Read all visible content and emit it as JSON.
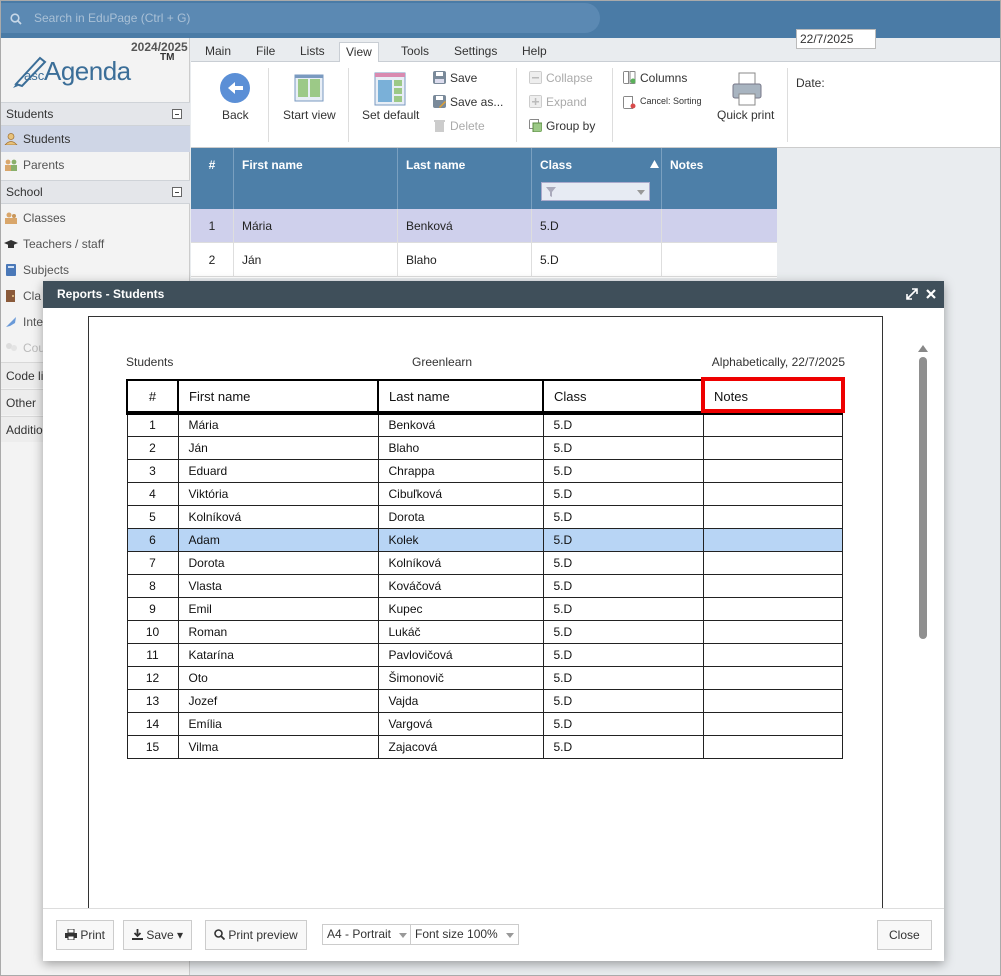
{
  "search": {
    "placeholder": "Search in EduPage (Ctrl + G)"
  },
  "brand": {
    "year": "2024/2025",
    "logo_prefix": "asc",
    "logo_name": "Agenda",
    "logo_tm": "TM"
  },
  "sidebar": {
    "sections": [
      {
        "label": "Students",
        "items": [
          {
            "label": "Students"
          },
          {
            "label": "Parents"
          }
        ]
      },
      {
        "label": "School",
        "items": [
          {
            "label": "Classes"
          },
          {
            "label": "Teachers / staff"
          },
          {
            "label": "Subjects"
          },
          {
            "label": "Cla"
          },
          {
            "label": "Inte"
          },
          {
            "label": "Cou"
          }
        ]
      }
    ],
    "plain_items": [
      {
        "label": "Code li"
      },
      {
        "label": "Other"
      },
      {
        "label": "Additio"
      }
    ]
  },
  "ribbon": {
    "tabs": [
      {
        "label": "Main"
      },
      {
        "label": "File"
      },
      {
        "label": "Lists"
      },
      {
        "label": "View"
      },
      {
        "label": "Tools"
      },
      {
        "label": "Settings"
      },
      {
        "label": "Help"
      }
    ],
    "back": "Back",
    "start_view": "Start view",
    "set_default": "Set default",
    "save": "Save",
    "save_as": "Save as...",
    "delete": "Delete",
    "collapse": "Collapse",
    "expand": "Expand",
    "group_by": "Group by",
    "columns": "Columns",
    "cancel_sorting": "Cancel: Sorting",
    "quick_print": "Quick print",
    "date_label": "Date:",
    "date_value": "22/7/2025"
  },
  "grid": {
    "headers": [
      "#",
      "First name",
      "Last name",
      "Class",
      "Notes"
    ],
    "rows": [
      {
        "num": "1",
        "first": "Mária",
        "last": "Benková",
        "cls": "5.D"
      },
      {
        "num": "2",
        "first": "Ján",
        "last": "Blaho",
        "cls": "5.D"
      }
    ]
  },
  "modal": {
    "title": "Reports - Students",
    "report": {
      "left_header": "Students",
      "center_header": "Greenlearn",
      "right_header": "Alphabetically, 22/7/2025",
      "columns": [
        "#",
        "First name",
        "Last name",
        "Class",
        "Notes"
      ],
      "rows": [
        {
          "num": "1",
          "first": "Mária",
          "last": "Benková",
          "cls": "5.D"
        },
        {
          "num": "2",
          "first": "Ján",
          "last": "Blaho",
          "cls": "5.D"
        },
        {
          "num": "3",
          "first": "Eduard",
          "last": "Chrappa",
          "cls": "5.D"
        },
        {
          "num": "4",
          "first": "Viktória",
          "last": "Cibuľková",
          "cls": "5.D"
        },
        {
          "num": "5",
          "first": "Kolníková",
          "last": "Dorota",
          "cls": "5.D"
        },
        {
          "num": "6",
          "first": "Adam",
          "last": "Kolek",
          "cls": "5.D"
        },
        {
          "num": "7",
          "first": "Dorota",
          "last": "Kolníková",
          "cls": "5.D"
        },
        {
          "num": "8",
          "first": "Vlasta",
          "last": "Kováčová",
          "cls": "5.D"
        },
        {
          "num": "9",
          "first": "Emil",
          "last": "Kupec",
          "cls": "5.D"
        },
        {
          "num": "10",
          "first": "Roman",
          "last": "Lukáč",
          "cls": "5.D"
        },
        {
          "num": "11",
          "first": "Katarína",
          "last": "Pavlovičová",
          "cls": "5.D"
        },
        {
          "num": "12",
          "first": "Oto",
          "last": "Šimonovič",
          "cls": "5.D"
        },
        {
          "num": "13",
          "first": "Jozef",
          "last": "Vajda",
          "cls": "5.D"
        },
        {
          "num": "14",
          "first": "Emília",
          "last": "Vargová",
          "cls": "5.D"
        },
        {
          "num": "15",
          "first": "Vilma",
          "last": "Zajacová",
          "cls": "5.D"
        }
      ]
    },
    "footer": {
      "print": "Print",
      "save": "Save",
      "print_preview": "Print preview",
      "paper_size": "A4 - Portrait",
      "font_size": "Font size 100%",
      "close": "Close"
    }
  },
  "colors": {
    "topbar": "#4a7ba6",
    "grid_header": "#4d7fa8",
    "selected_row": "#cfd0ec",
    "report_highlight_row": "#b8d5f5",
    "annotation_box": "#ee0000",
    "modal_title": "#3f4f5a"
  },
  "icons": [
    "search-icon",
    "back-arrow-icon",
    "start-view-icon",
    "set-default-icon",
    "save-icon",
    "save-as-icon",
    "delete-icon",
    "collapse-icon",
    "expand-icon",
    "group-by-icon",
    "columns-icon",
    "cancel-sorting-icon",
    "printer-icon",
    "filter-icon",
    "sort-asc-icon",
    "maximize-icon",
    "close-icon",
    "download-icon",
    "magnifier-icon"
  ]
}
